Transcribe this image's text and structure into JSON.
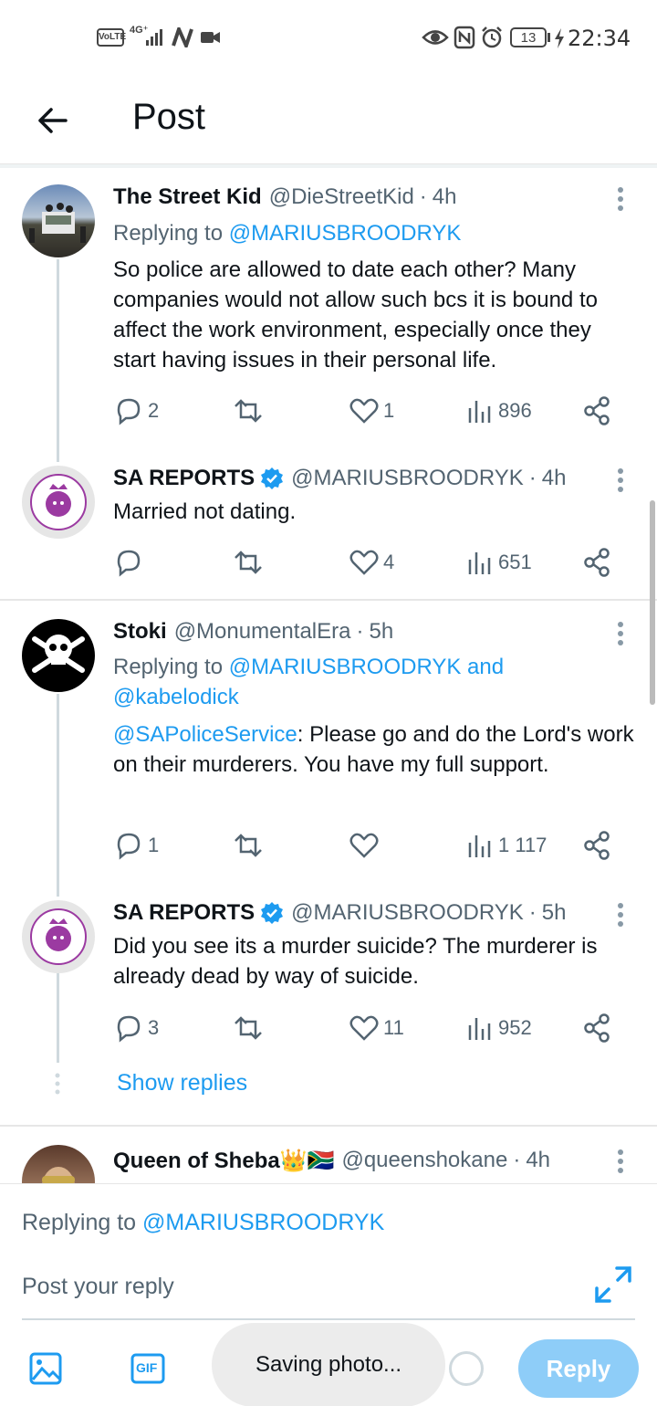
{
  "status_bar": {
    "volte": "VoLTE",
    "network": "4G⁺",
    "battery": "13",
    "time": "22:34"
  },
  "header": {
    "title": "Post"
  },
  "tweets": [
    {
      "name": "The Street Kid",
      "handle": "@DieStreetKid",
      "time": "4h",
      "replying_prefix": "Replying to ",
      "replying_to": "@MARIUSBROODRYK",
      "text": "So police are allowed to date each other? Many companies would not allow such bcs it is bound to affect the work environment, especially once they start having issues in their personal life.",
      "replies": "2",
      "reposts": "",
      "likes": "1",
      "views": "896"
    },
    {
      "name": "SA REPORTS",
      "handle": "@MARIUSBROODRYK",
      "time": "4h",
      "text": "Married not dating.",
      "replies": "",
      "reposts": "",
      "likes": "4",
      "views": "651"
    },
    {
      "name": "Stoki",
      "handle": "@MonumentalEra",
      "time": "5h",
      "replying_prefix": "Replying to ",
      "replying_to": "@MARIUSBROODRYK and",
      "replying_to_2": "@kabelodick",
      "mention": "@SAPoliceService",
      "text": ": Please go and do the Lord's work on their murderers. You have my full support.",
      "replies": "1",
      "reposts": "",
      "likes": "",
      "views": "1 117"
    },
    {
      "name": "SA REPORTS",
      "handle": "@MARIUSBROODRYK",
      "time": "5h",
      "text": "Did you see its a murder suicide? The murderer is already dead by way of suicide.",
      "replies": "3",
      "reposts": "",
      "likes": "11",
      "views": "952"
    },
    {
      "name": "Queen of Sheba👑🇿🇦",
      "handle": "@queenshokane",
      "time": "4h"
    }
  ],
  "show_replies": "Show replies",
  "separator_dot": "·",
  "compose": {
    "replying_prefix": "Replying to ",
    "replying_to": "@MARIUSBROODRYK",
    "placeholder": "Post your reply",
    "toast": "Saving photo...",
    "reply_button": "Reply",
    "gif_label": "GIF"
  },
  "colors": {
    "accent": "#1d9bf0",
    "reply_button": "#8ecdf8",
    "muted_text": "#536471",
    "thread_line": "#cfd9de"
  },
  "icons": [
    "back-arrow-icon",
    "more-vertical-icon",
    "reply-icon",
    "repost-icon",
    "like-icon",
    "views-icon",
    "share-icon",
    "verified-badge-icon",
    "image-icon",
    "gif-icon",
    "expand-icon"
  ]
}
